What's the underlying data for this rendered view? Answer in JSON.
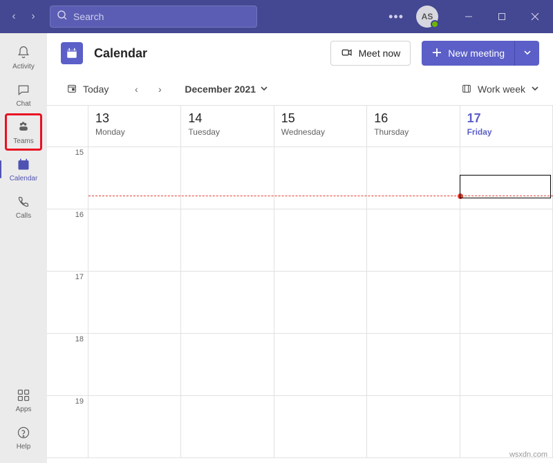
{
  "titlebar": {
    "search_placeholder": "Search",
    "avatar_initials": "AS"
  },
  "rail": {
    "items": [
      {
        "name": "activity",
        "label": "Activity"
      },
      {
        "name": "chat",
        "label": "Chat"
      },
      {
        "name": "teams",
        "label": "Teams"
      },
      {
        "name": "calendar",
        "label": "Calendar"
      },
      {
        "name": "calls",
        "label": "Calls"
      }
    ],
    "bottom": [
      {
        "name": "apps",
        "label": "Apps"
      },
      {
        "name": "help",
        "label": "Help"
      }
    ]
  },
  "header": {
    "title": "Calendar",
    "meet_now": "Meet now",
    "new_meeting": "New meeting"
  },
  "toolbar": {
    "today": "Today",
    "month_label": "December 2021",
    "view_label": "Work week"
  },
  "days": [
    {
      "num": "13",
      "name": "Monday"
    },
    {
      "num": "14",
      "name": "Tuesday"
    },
    {
      "num": "15",
      "name": "Wednesday"
    },
    {
      "num": "16",
      "name": "Thursday"
    },
    {
      "num": "17",
      "name": "Friday"
    }
  ],
  "hours": [
    "15",
    "16",
    "17",
    "18",
    "19"
  ],
  "watermark": "wsxdn.com"
}
